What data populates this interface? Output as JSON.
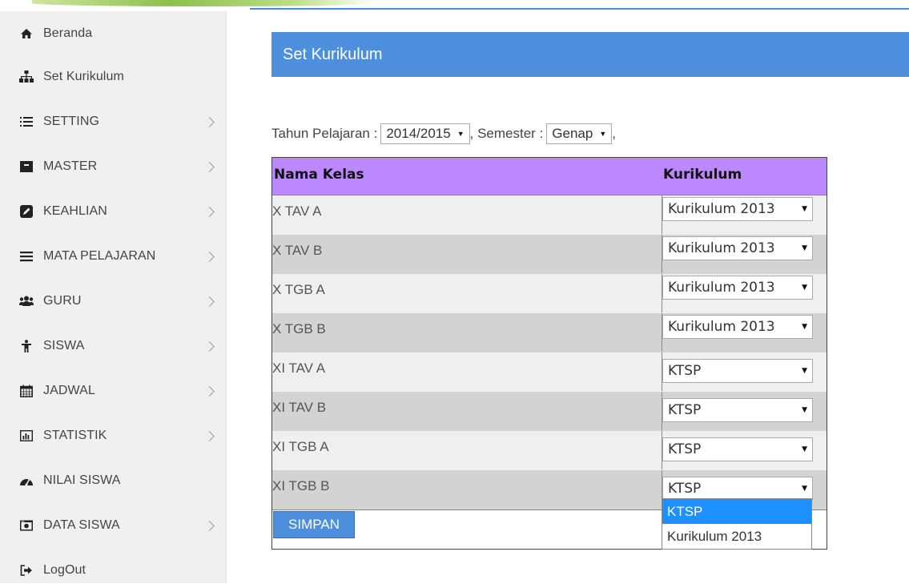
{
  "sidebar": {
    "items": [
      {
        "label": "Beranda",
        "icon": "home-icon",
        "submenu": false
      },
      {
        "label": "Set Kurikulum",
        "icon": "sitemap-icon",
        "submenu": false
      },
      {
        "label": "SETTING",
        "icon": "list-icon",
        "submenu": true
      },
      {
        "label": "MASTER",
        "icon": "archive-icon",
        "submenu": true
      },
      {
        "label": "KEAHLIAN",
        "icon": "edit-icon",
        "submenu": true
      },
      {
        "label": "MATA PELAJARAN",
        "icon": "menu-icon",
        "submenu": true
      },
      {
        "label": "GURU",
        "icon": "users-icon",
        "submenu": true
      },
      {
        "label": "SISWA",
        "icon": "child-icon",
        "submenu": true
      },
      {
        "label": "JADWAL",
        "icon": "calendar-icon",
        "submenu": true
      },
      {
        "label": "STATISTIK",
        "icon": "bar-chart-icon",
        "submenu": true
      },
      {
        "label": "NILAI SISWA",
        "icon": "dashboard-icon",
        "submenu": false
      },
      {
        "label": "DATA SISWA",
        "icon": "camera-icon",
        "submenu": true
      },
      {
        "label": "LogOut",
        "icon": "sign-out-icon",
        "submenu": false
      }
    ]
  },
  "page": {
    "title": "Set Kurikulum"
  },
  "filters": {
    "year_label": "Tahun Pelajaran :",
    "year_value": "2014/2015",
    "semester_label": "Semester :",
    "semester_value": "Genap"
  },
  "table": {
    "headers": [
      "Nama Kelas",
      "Kurikulum"
    ],
    "rows": [
      {
        "name": "X TAV A",
        "kurikulum": "Kurikulum 2013"
      },
      {
        "name": "X TAV B",
        "kurikulum": "Kurikulum 2013"
      },
      {
        "name": "X TGB A",
        "kurikulum": "Kurikulum 2013"
      },
      {
        "name": "X TGB B",
        "kurikulum": "Kurikulum 2013"
      },
      {
        "name": "XI TAV A",
        "kurikulum": "KTSP"
      },
      {
        "name": "XI TAV B",
        "kurikulum": "KTSP"
      },
      {
        "name": "XI TGB A",
        "kurikulum": "KTSP"
      },
      {
        "name": "XI TGB B",
        "kurikulum": "KTSP"
      }
    ],
    "save_label": "SIMPAN"
  },
  "dropdown": {
    "options": [
      "KTSP",
      "Kurikulum 2013"
    ],
    "highlighted": "KTSP"
  },
  "colors": {
    "header_blue": "#4d8fdc",
    "table_header_purple": "#bb88ff",
    "accent_green": "#8cc04b"
  }
}
